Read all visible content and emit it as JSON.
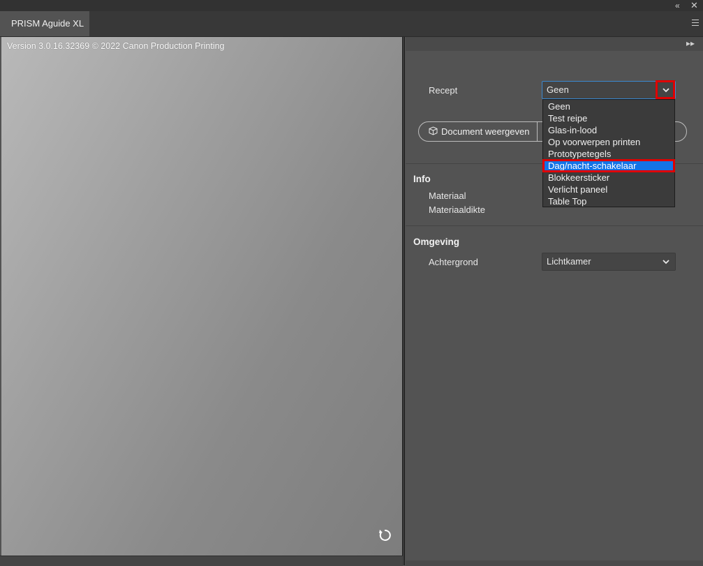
{
  "app": {
    "tab_title": "PRISM Aguide XL",
    "collapse_icon": "«",
    "close_icon": "✕"
  },
  "preview": {
    "version_text": "Version 3.0.16.32369 © 2022 Canon Production Printing"
  },
  "panel": {
    "expand_icon": "▸▸",
    "recept": {
      "label": "Recept",
      "selected": "Geen",
      "options": [
        "Geen",
        "Test reipe",
        "Glas-in-lood",
        "Op voorwerpen printen",
        "Prototypetegels",
        "Dag/nacht-schakelaar",
        "Blokkeersticker",
        "Verlicht paneel",
        "Table Top"
      ],
      "highlighted_index": 5
    },
    "document_button_label": "Document weergeven",
    "info": {
      "title": "Info",
      "materiaal_label": "Materiaal",
      "materiaaldikte_label": "Materiaaldikte"
    },
    "omgeving": {
      "title": "Omgeving",
      "achtergrond_label": "Achtergrond",
      "achtergrond_value": "Lichtkamer"
    }
  },
  "colors": {
    "accent": "#1473e6",
    "highlight_border": "#e00000",
    "panel_bg": "#535353"
  }
}
